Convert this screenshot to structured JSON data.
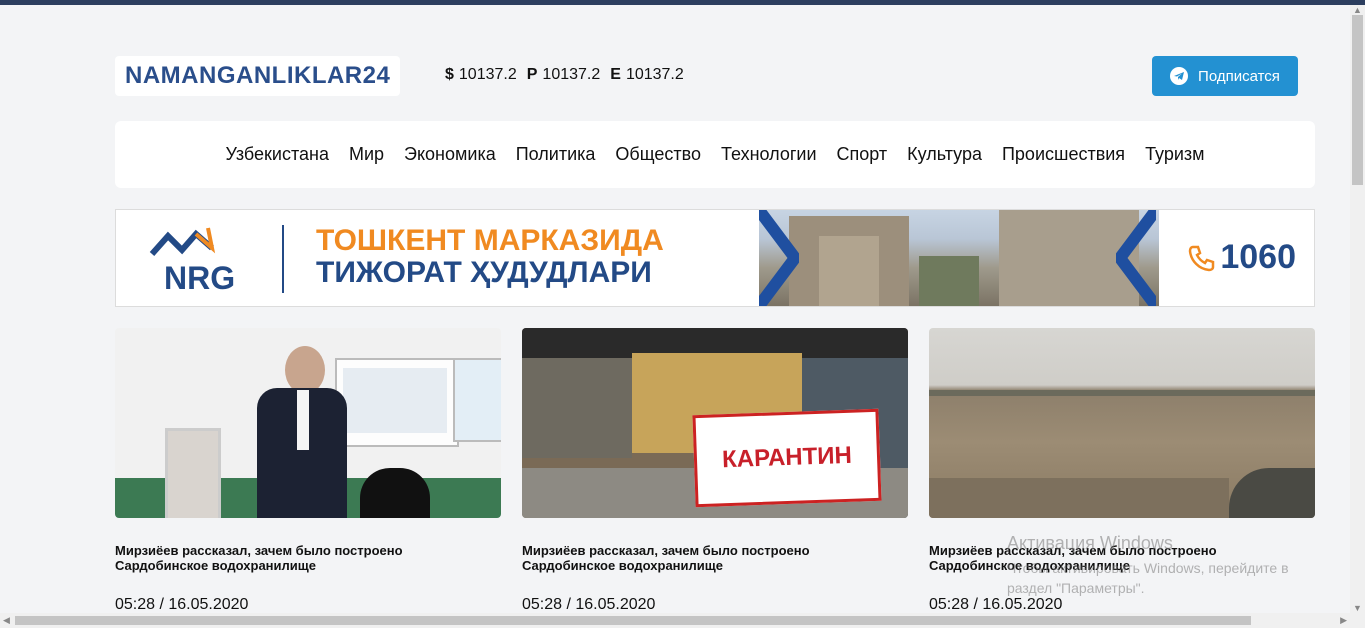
{
  "header": {
    "logo_text": "NAMANGANLIKLAR24",
    "rates": [
      {
        "symbol": "$",
        "value": "10137.2"
      },
      {
        "symbol": "P",
        "value": "10137.2"
      },
      {
        "symbol": "E",
        "value": "10137.2"
      }
    ],
    "subscribe_label": "Подписатся"
  },
  "nav": {
    "items": [
      "Узбекистана",
      "Мир",
      "Экономика",
      "Политика",
      "Общество",
      "Технологии",
      "Спорт",
      "Культура",
      "Происшествия",
      "Туризм"
    ]
  },
  "banner": {
    "brand": "NRG",
    "line1": "ТОШКЕНТ МАРКАЗИДА",
    "line2": "ТИЖОРАТ ҲУДУДЛАРИ",
    "phone": "1060"
  },
  "cards": [
    {
      "title": "Мирзиёев рассказал, зачем было построено Сардобинское водохранилище",
      "time": "05:28 / 16.05.2020"
    },
    {
      "title": "Мирзиёев рассказал, зачем было построено Сардобинское водохранилище",
      "time": "05:28 / 16.05.2020",
      "photo_text": "КАРАНТИН"
    },
    {
      "title": "Мирзиёев рассказал, зачем было построено Сардобинское водохранилище",
      "time": "05:28 / 16.05.2020"
    }
  ],
  "watermark": {
    "title": "Активация Windows",
    "text": "Чтобы активировать Windows, перейдите в раздел \"Параметры\"."
  },
  "colors": {
    "brand_blue": "#2a4e8b",
    "subscribe_blue": "#2391d2",
    "banner_orange": "#f08a21"
  }
}
